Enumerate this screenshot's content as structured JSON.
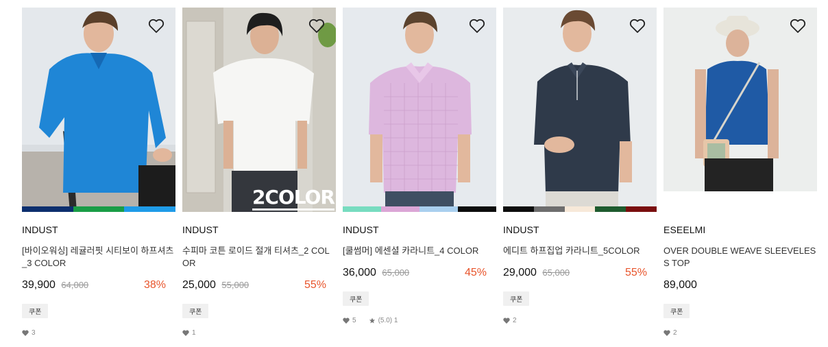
{
  "products": [
    {
      "brand": "INDUST",
      "title": "[바이오워싱] 레귤러핏 시티보이 하프셔츠_3 COLOR",
      "price": "39,900",
      "original_price": "64,000",
      "discount": "38%",
      "coupon": "쿠폰",
      "likes": "3",
      "review": "",
      "colors": [
        "#0d2f6e",
        "#1a9d46",
        "#1f9be8"
      ],
      "image_badge": ""
    },
    {
      "brand": "INDUST",
      "title": "수피마 코튼 로이드 절개 티셔츠_2 COLOR",
      "price": "25,000",
      "original_price": "55,000",
      "discount": "55%",
      "coupon": "쿠폰",
      "likes": "1",
      "review": "",
      "colors": [],
      "image_badge": "2COLOR"
    },
    {
      "brand": "INDUST",
      "title": "[쿨썸머] 에센셜 카라니트_4 COLOR",
      "price": "36,000",
      "original_price": "65,000",
      "discount": "45%",
      "coupon": "쿠폰",
      "likes": "5",
      "review": "(5.0) 1",
      "colors": [
        "#78dcc0",
        "#dba6d6",
        "#a9cfee",
        "#0d0d0d"
      ],
      "image_badge": ""
    },
    {
      "brand": "INDUST",
      "title": "에디트 하프집업 카라니트_5COLOR",
      "price": "29,000",
      "original_price": "65,000",
      "discount": "55%",
      "coupon": "쿠폰",
      "likes": "2",
      "review": "",
      "colors": [
        "#0d0d0d",
        "#6e6e6e",
        "#f7e9d9",
        "#1e5b2e",
        "#7a0f0f"
      ],
      "image_badge": ""
    },
    {
      "brand": "ESEELMI",
      "title": "OVER DOUBLE WEAVE SLEEVELESS TOP",
      "price": "89,000",
      "original_price": "",
      "discount": "",
      "coupon": "쿠폰",
      "likes": "2",
      "review": "",
      "colors": [],
      "image_badge": ""
    }
  ],
  "icons": {
    "wishlist": "heart-outline-icon",
    "likes": "heart-small-icon",
    "review": "star-icon"
  }
}
